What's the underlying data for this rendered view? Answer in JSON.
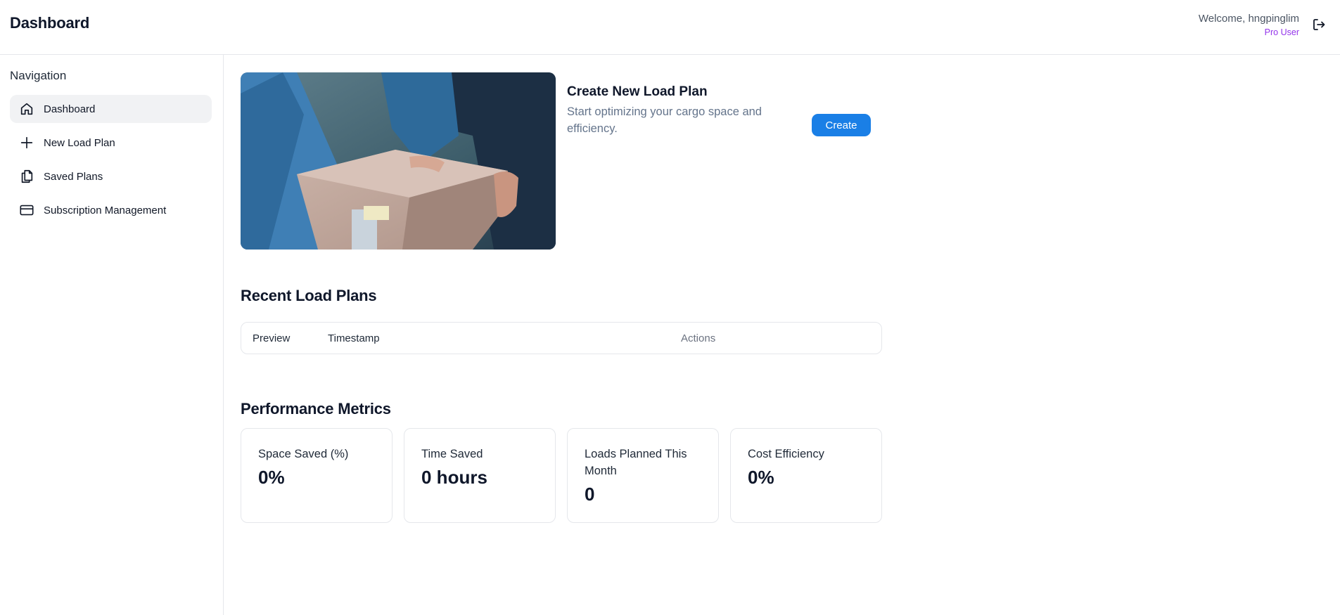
{
  "header": {
    "title": "Dashboard",
    "welcome": "Welcome, hngpinglim",
    "plan": "Pro User",
    "logout_icon": "logout-icon"
  },
  "sidebar": {
    "heading": "Navigation",
    "items": [
      {
        "label": "Dashboard",
        "icon": "home-icon",
        "active": true
      },
      {
        "label": "New Load Plan",
        "icon": "plus-icon",
        "active": false
      },
      {
        "label": "Saved Plans",
        "icon": "copy-icon",
        "active": false
      },
      {
        "label": "Subscription Management",
        "icon": "credit-card-icon",
        "active": false
      }
    ]
  },
  "create_card": {
    "title": "Create New Load Plan",
    "description": "Start optimizing your cargo space and efficiency.",
    "button_label": "Create",
    "image_alt": "hands passing a cardboard box"
  },
  "recent": {
    "title": "Recent Load Plans",
    "columns": [
      "Preview",
      "Timestamp",
      "Actions"
    ]
  },
  "metrics": {
    "title": "Performance Metrics",
    "cards": [
      {
        "label": "Space Saved (%)",
        "value": "0%"
      },
      {
        "label": "Time Saved",
        "value": "0 hours"
      },
      {
        "label": "Loads Planned This Month",
        "value": "0"
      },
      {
        "label": "Cost Efficiency",
        "value": "0%"
      }
    ]
  },
  "colors": {
    "accent": "#1a7fe6",
    "pro_badge": "#9333ea",
    "active_nav_bg": "#f1f2f4"
  }
}
